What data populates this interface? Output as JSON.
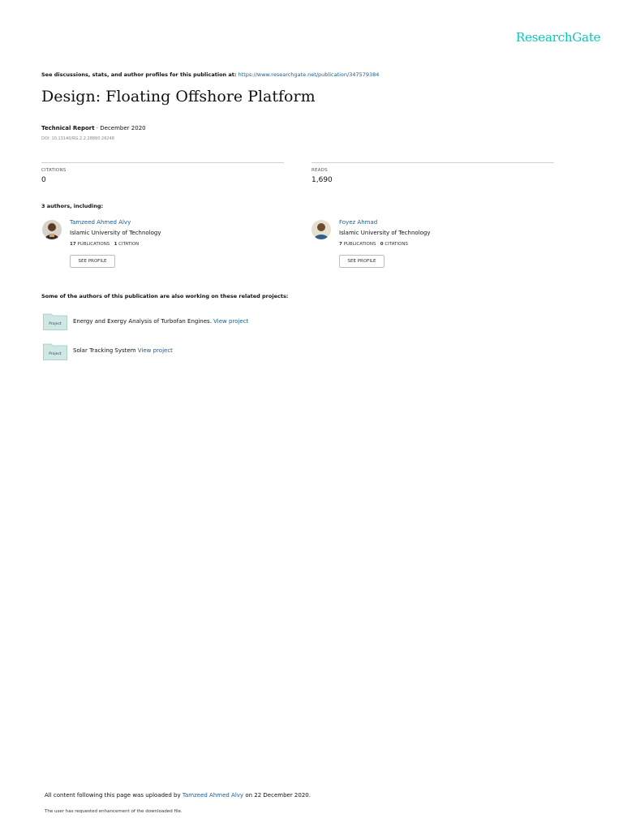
{
  "brand": {
    "name": "ResearchGate",
    "color": "#00ccbb"
  },
  "top_line": {
    "text": "See discussions, stats, and author profiles for this publication at:",
    "url": "https://www.researchgate.net/publication/347579384"
  },
  "publication": {
    "title": "Design: Floating Offshore Platform",
    "type": "Technical Report",
    "separator": " · ",
    "date": "December 2020",
    "doi": "DOI: 10.13140/RG.2.2.28860.26248"
  },
  "stats": {
    "citations": {
      "label": "CITATIONS",
      "value": "0"
    },
    "reads": {
      "label": "READS",
      "value": "1,690"
    }
  },
  "authors_heading": "3 authors, including:",
  "authors": [
    {
      "name": "Tamzeed Ahmed Alvy",
      "institution": "Islamic University of Technology",
      "publications_count": "17",
      "publications_label": "PUBLICATIONS",
      "citations_count": "1",
      "citations_label": "CITATION",
      "button": "SEE PROFILE"
    },
    {
      "name": "Foyez Ahmad",
      "institution": "Islamic University of Technology",
      "publications_count": "7",
      "publications_label": "PUBLICATIONS",
      "citations_count": "0",
      "citations_label": "CITATIONS",
      "button": "SEE PROFILE"
    }
  ],
  "projects_heading": "Some of the authors of this publication are also working on these related projects:",
  "projects": [
    {
      "icon_label": "Project",
      "title": "Energy and Exergy Analysis of Turbofan Engines.",
      "link": "View project"
    },
    {
      "icon_label": "Project",
      "title": "Solar Tracking System",
      "link": "View project"
    }
  ],
  "footer": {
    "prefix": "All content following this page was uploaded by",
    "uploader": "Tamzeed Ahmed Alvy",
    "suffix": "on 22 December 2020.",
    "note": "The user has requested enhancement of the downloaded file."
  },
  "colors": {
    "link": "#1a5b92",
    "rule": "#cfcfcf",
    "folder": "#cfe8e4"
  }
}
